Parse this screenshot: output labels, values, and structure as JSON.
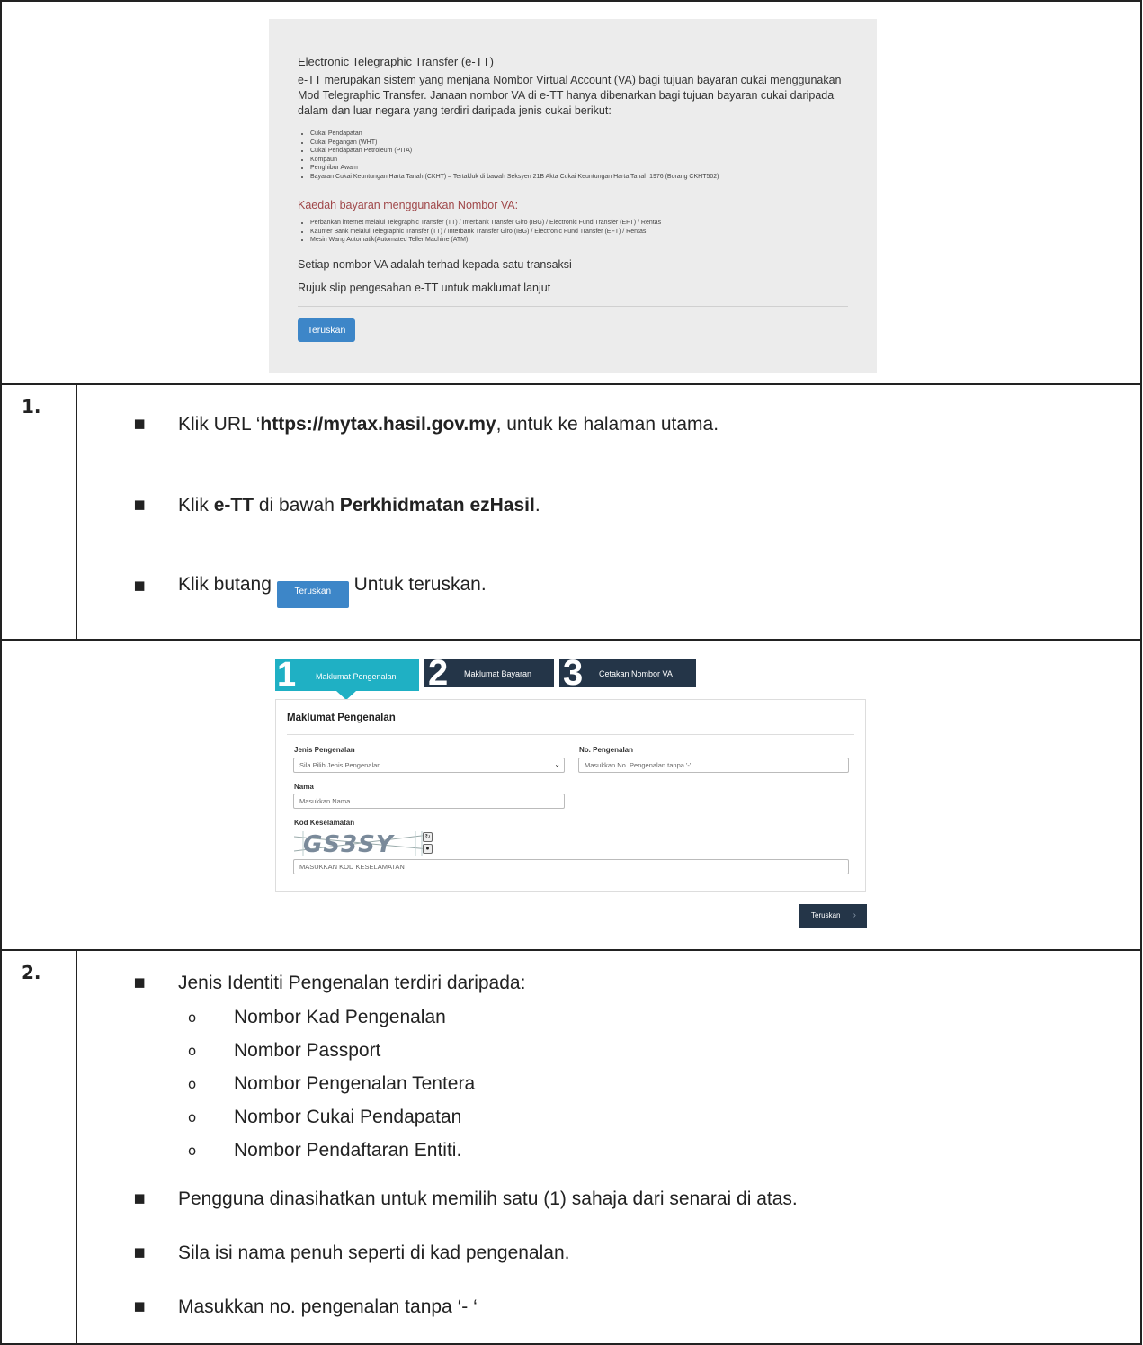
{
  "info": {
    "title": "Electronic Telegraphic Transfer (e-TT)",
    "paragraph": "e-TT merupakan sistem yang menjana Nombor Virtual Account (VA) bagi tujuan bayaran cukai menggunakan Mod Telegraphic Transfer. Janaan nombor VA di e-TT hanya dibenarkan bagi tujuan bayaran cukai daripada dalam dan luar negara yang terdiri daripada jenis cukai berikut:",
    "tax_types": [
      "Cukai Pendapatan",
      "Cukai Pegangan (WHT)",
      "Cukai Pendapatan Petroleum (PITA)",
      "Kompaun",
      "Penghibur Awam",
      "Bayaran Cukai Keuntungan Harta Tanah (CKHT) – Tertakluk di bawah Seksyen 21B Akta Cukai Keuntungan Harta Tanah 1976 (Borang CKHT502)"
    ],
    "method_heading": "Kaedah bayaran menggunakan Nombor VA:",
    "methods": [
      "Perbankan internet melalui Telegraphic Transfer (TT) / Interbank Transfer Giro (IBG) / Electronic Fund Transfer (EFT) / Rentas",
      "Kaunter Bank melalui Telegraphic Transfer (TT) / Interbank Transfer Giro (IBG) / Electronic Fund Transfer (EFT) / Rentas",
      "Mesin Wang Automatik(Automated Teller Machine (ATM)"
    ],
    "note1": "Setiap nombor VA adalah terhad kepada satu transaksi",
    "note2": "Rujuk slip pengesahan e-TT untuk maklumat lanjut",
    "button": "Teruskan"
  },
  "step1": {
    "number": "1.",
    "b1_pre": "Klik URL ‘",
    "b1_url": "https://mytax.hasil.gov.my",
    "b1_post": ", untuk ke halaman utama.",
    "b2_pre": "Klik ",
    "b2_b1": "e-TT",
    "b2_mid": " di bawah ",
    "b2_b2": "Perkhidmatan ezHasil",
    "b2_post": ".",
    "b3_pre": "Klik butang ",
    "b3_btn": "Teruskan",
    "b3_post": " Untuk teruskan."
  },
  "form": {
    "steps": [
      {
        "num": "1",
        "label": "Maklumat Pengenalan"
      },
      {
        "num": "2",
        "label": "Maklumat Bayaran"
      },
      {
        "num": "3",
        "label": "Cetakan Nombor VA"
      }
    ],
    "title": "Maklumat Pengenalan",
    "jenis_label": "Jenis Pengenalan",
    "jenis_value": "Sila Pilih Jenis Pengenalan",
    "no_label": "No. Pengenalan",
    "no_placeholder": "Masukkan No. Pengenalan tanpa '-'",
    "nama_label": "Nama",
    "nama_placeholder": "Masukkan Nama",
    "kod_label": "Kod Keselamatan",
    "captcha": "GS3SY",
    "kod_placeholder": "MASUKKAN KOD KESELAMATAN",
    "button": "Teruskan"
  },
  "step2": {
    "number": "2.",
    "intro": "Jenis Identiti Pengenalan terdiri daripada:",
    "types": [
      "Nombor Kad Pengenalan",
      "Nombor Passport",
      "Nombor Pengenalan Tentera",
      "Nombor Cukai Pendapatan",
      "Nombor Pendaftaran Entiti."
    ],
    "n1": "Pengguna dinasihatkan untuk memilih satu (1) sahaja dari senarai di atas.",
    "n2": "Sila isi nama penuh seperti di kad pengenalan.",
    "n3": "Masukkan no. pengenalan tanpa ‘- ‘"
  }
}
